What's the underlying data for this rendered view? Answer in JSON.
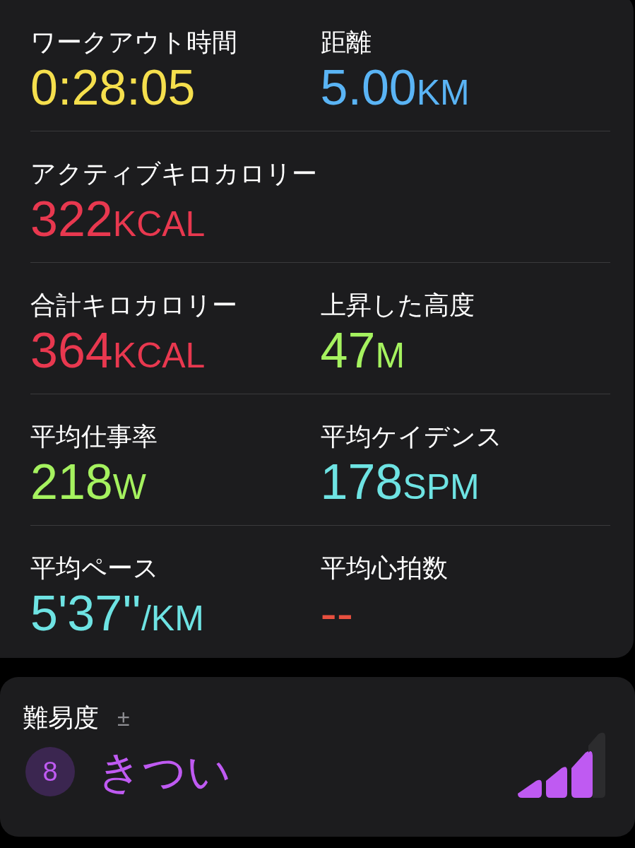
{
  "metrics_card": {
    "rows": [
      {
        "cells": [
          {
            "label": "ワークアウト時間",
            "value": "0:28:05",
            "color": "#f5df4d"
          },
          {
            "label": "距離",
            "value": "5.00",
            "unit": "KM",
            "color": "#5ab4f5"
          }
        ]
      },
      {
        "cells": [
          {
            "label": "アクティブキロカロリー",
            "value": "322",
            "unit": "KCAL",
            "color": "#e8384f"
          }
        ]
      },
      {
        "cells": [
          {
            "label": "合計キロカロリー",
            "value": "364",
            "unit": "KCAL",
            "color": "#e8384f"
          },
          {
            "label": "上昇した高度",
            "value": "47",
            "unit": "M",
            "color": "#a5f25f"
          }
        ]
      },
      {
        "cells": [
          {
            "label": "平均仕事率",
            "value": "218",
            "unit": "W",
            "color": "#a5f25f"
          },
          {
            "label": "平均ケイデンス",
            "value": "178",
            "unit": "SPM",
            "color": "#6ee3e3"
          }
        ]
      },
      {
        "cells": [
          {
            "label": "平均ペース",
            "value": "5'37''",
            "unit": "/KM",
            "color": "#6ee3e3"
          },
          {
            "label": "平均心拍数",
            "value": "--",
            "color": "#e8503f"
          }
        ]
      }
    ]
  },
  "effort_card": {
    "label": "難易度",
    "adjust": "±",
    "score": "8",
    "rating": "きつい"
  }
}
